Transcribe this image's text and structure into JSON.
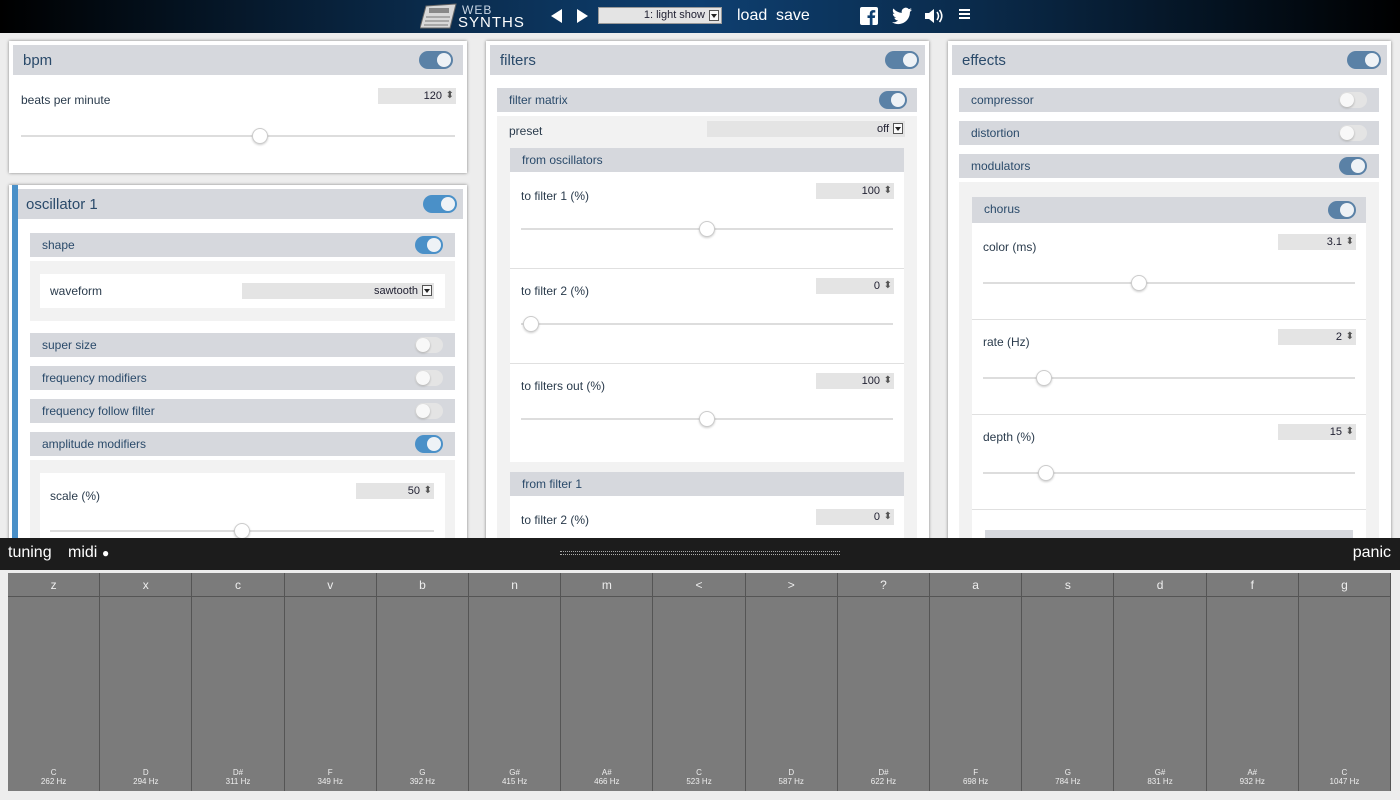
{
  "topbar": {
    "logo_top": "WEB",
    "logo_bottom": "SYNTHS",
    "preset": "1: light show",
    "load_label": "load",
    "save_label": "save",
    "icons": [
      "facebook-icon",
      "twitter-icon",
      "volume-icon",
      "menu-icon"
    ]
  },
  "bpm": {
    "title": "bpm",
    "label": "beats per minute",
    "value": "120",
    "slider_fraction": 0.55,
    "enabled": true
  },
  "oscillator": {
    "title": "oscillator 1",
    "enabled": true,
    "shape": {
      "label": "shape",
      "enabled": true,
      "waveform_label": "waveform",
      "waveform": "sawtooth"
    },
    "super_size": {
      "label": "super size",
      "enabled": false
    },
    "frequency_modifiers": {
      "label": "frequency modifiers",
      "enabled": false
    },
    "frequency_follow_filter": {
      "label": "frequency follow filter",
      "enabled": false
    },
    "amplitude_modifiers": {
      "label": "amplitude modifiers",
      "enabled": true
    },
    "scale": {
      "label": "scale (%)",
      "value": "50",
      "slider_fraction": 0.5
    },
    "accent_color": "#4a90c8"
  },
  "filters": {
    "title": "filters",
    "enabled": true,
    "matrix": {
      "label": "filter matrix",
      "enabled": true
    },
    "preset_label": "preset",
    "preset_value": "off",
    "from_osc": {
      "label": "from oscillators",
      "rows": [
        {
          "label": "to filter 1 (%)",
          "value": "100",
          "slider_fraction": 0.5
        },
        {
          "label": "to filter 2 (%)",
          "value": "0",
          "slider_fraction": 0.0
        },
        {
          "label": "to filters out (%)",
          "value": "100",
          "slider_fraction": 0.5
        }
      ]
    },
    "from_filter1": {
      "label": "from filter 1",
      "rows": [
        {
          "label": "to filter 2 (%)",
          "value": "0"
        }
      ]
    }
  },
  "effects": {
    "title": "effects",
    "enabled": true,
    "compressor": {
      "label": "compressor",
      "enabled": false
    },
    "distortion": {
      "label": "distortion",
      "enabled": false
    },
    "modulators": {
      "label": "modulators",
      "enabled": true
    },
    "chorus": {
      "label": "chorus",
      "enabled": true,
      "rows": [
        {
          "label": "color (ms)",
          "value": "3.1",
          "slider_fraction": 0.42
        },
        {
          "label": "rate (Hz)",
          "value": "2",
          "slider_fraction": 0.16
        },
        {
          "label": "depth (%)",
          "value": "15",
          "slider_fraction": 0.17
        }
      ]
    }
  },
  "keyboard_bar": {
    "tuning": "tuning",
    "midi": "midi",
    "midi_dot": "●",
    "panic": "panic"
  },
  "keys": [
    {
      "key": "z",
      "note": "C",
      "hz": "262 Hz"
    },
    {
      "key": "x",
      "note": "D",
      "hz": "294 Hz"
    },
    {
      "key": "c",
      "note": "D#",
      "hz": "311 Hz"
    },
    {
      "key": "v",
      "note": "F",
      "hz": "349 Hz"
    },
    {
      "key": "b",
      "note": "G",
      "hz": "392 Hz"
    },
    {
      "key": "n",
      "note": "G#",
      "hz": "415 Hz"
    },
    {
      "key": "m",
      "note": "A#",
      "hz": "466 Hz"
    },
    {
      "key": "<",
      "note": "C",
      "hz": "523 Hz"
    },
    {
      "key": ">",
      "note": "D",
      "hz": "587 Hz"
    },
    {
      "key": "?",
      "note": "D#",
      "hz": "622 Hz"
    },
    {
      "key": "a",
      "note": "F",
      "hz": "698 Hz"
    },
    {
      "key": "s",
      "note": "G",
      "hz": "784 Hz"
    },
    {
      "key": "d",
      "note": "G#",
      "hz": "831 Hz"
    },
    {
      "key": "f",
      "note": "A#",
      "hz": "932 Hz"
    },
    {
      "key": "g",
      "note": "C",
      "hz": "1047 Hz"
    }
  ]
}
